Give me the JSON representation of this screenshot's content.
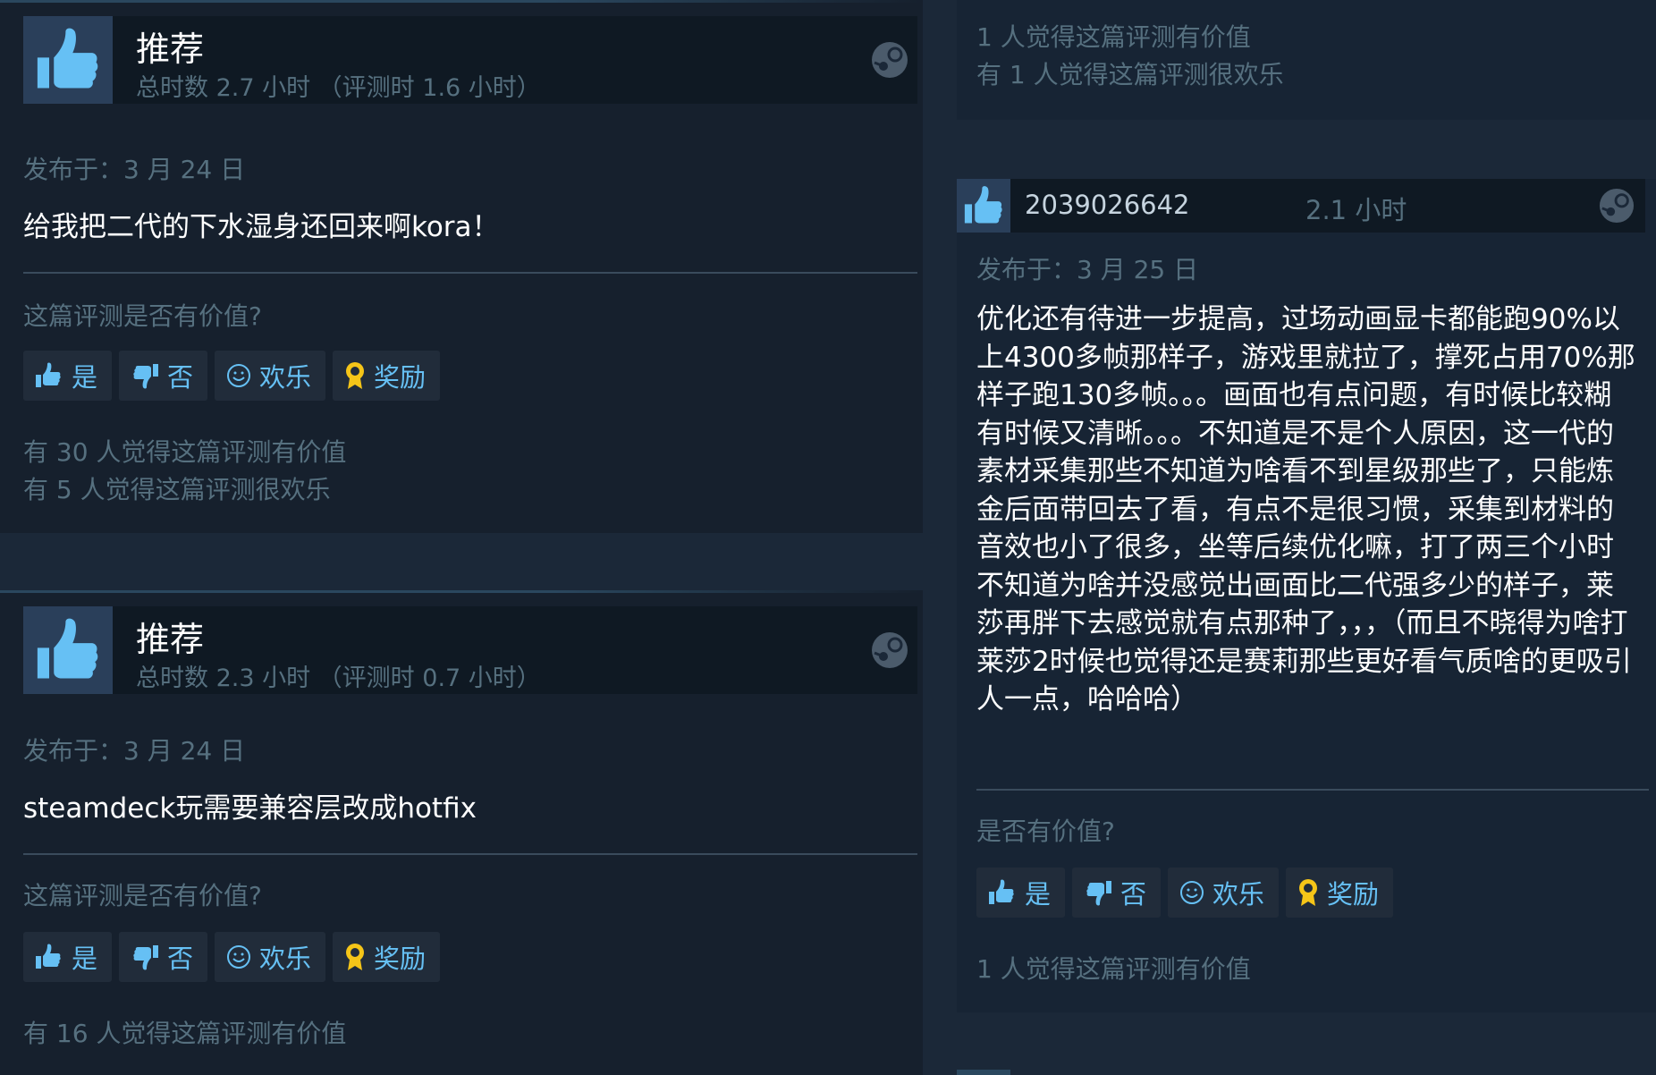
{
  "reviews_left": [
    {
      "title": "推荐",
      "playtime": "总时数 2.7 小时 （评测时 1.6 小时）",
      "posted": "发布于：3 月 24 日",
      "content": "给我把二代的下水湿身还回来啊kora！",
      "helpful_question": "这篇评测是否有价值?",
      "buttons": {
        "yes": "是",
        "no": "否",
        "funny": "欢乐",
        "award": "奖励"
      },
      "stats": [
        "有 30 人觉得这篇评测有价值",
        "有 5 人觉得这篇评测很欢乐"
      ]
    },
    {
      "title": "推荐",
      "playtime": "总时数 2.3 小时 （评测时 0.7 小时）",
      "posted": "发布于：3 月 24 日",
      "content": "steamdeck玩需要兼容层改成hotfix",
      "helpful_question": "这篇评测是否有价值?",
      "buttons": {
        "yes": "是",
        "no": "否",
        "funny": "欢乐",
        "award": "奖励"
      },
      "stats": [
        "有 16 人觉得这篇评测有价值"
      ]
    }
  ],
  "reviews_right": {
    "top_stats": [
      "1 人觉得这篇评测有价值",
      "有 1 人觉得这篇评测很欢乐"
    ],
    "review": {
      "username": "2039026642",
      "hours": "2.1 小时",
      "posted": "发布于：3 月 25 日",
      "content": "优化还有待进一步提高，过场动画显卡都能跑90%以上4300多帧那样子，游戏里就拉了，撑死占用70%那样子跑130多帧。。。画面也有点问题，有时候比较糊有时候又清晰。。。不知道是不是个人原因，这一代的素材采集那些不知道为啥看不到星级那些了，只能炼金后面带回去了看，有点不是很习惯，采集到材料的音效也小了很多，坐等后续优化嘛，打了两三个小时不知道为啥并没感觉出画面比二代强多少的样子，莱莎再胖下去感觉就有点那种了，，，（而且不晓得为啥打莱莎2时候也觉得还是赛莉那些更好看气质啥的更吸引人一点，哈哈哈）",
      "helpful_question": "是否有价值?",
      "buttons": {
        "yes": "是",
        "no": "否",
        "funny": "欢乐",
        "award": "奖励"
      },
      "stats": [
        "1 人觉得这篇评测有价值"
      ]
    }
  },
  "colors": {
    "page_bg": "#1b2838",
    "panel_bg": "#16202d",
    "header_bg": "#0f1923",
    "link_blue": "#66c0f4",
    "muted_text": "#56707f",
    "award_gold": "#f5c518"
  },
  "icons": [
    "thumbs-up-icon",
    "thumbs-down-icon",
    "smiley-icon",
    "award-icon",
    "steam-logo-icon"
  ]
}
